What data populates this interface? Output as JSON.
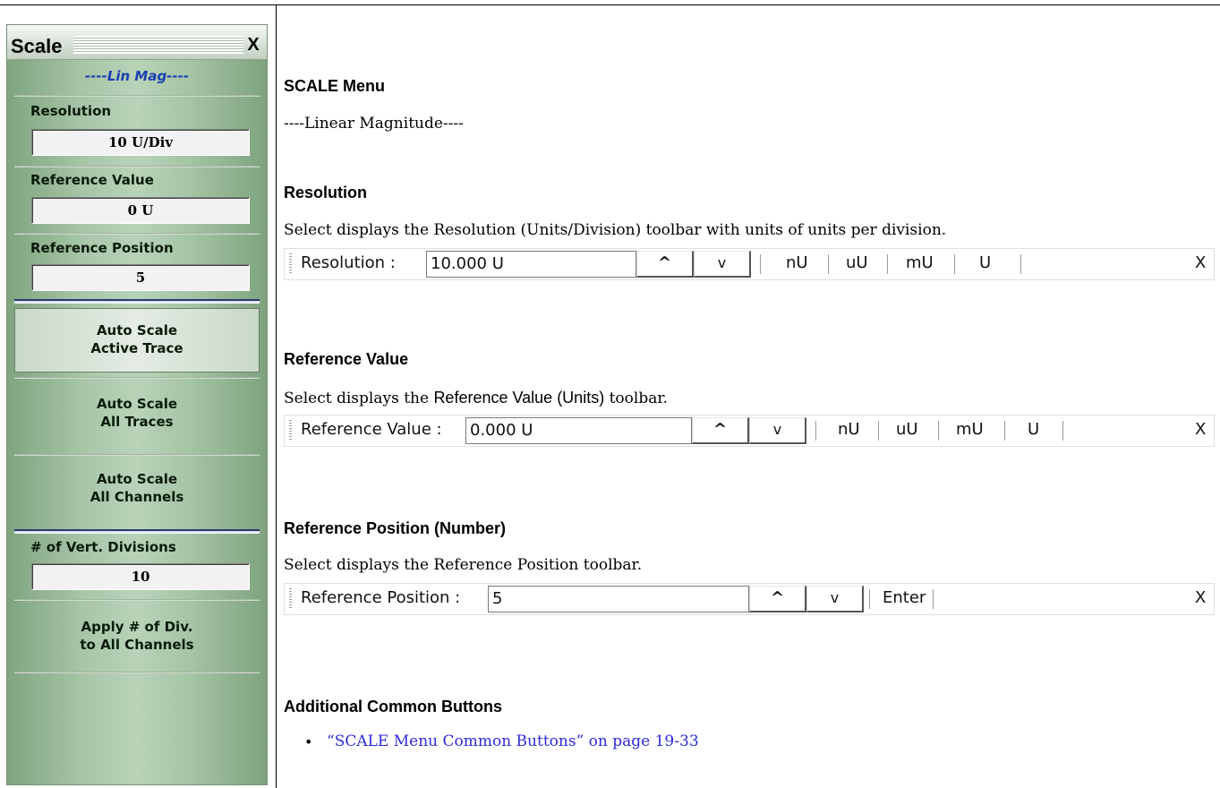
{
  "menu": {
    "title": "Scale",
    "close_label": "X",
    "subtitle": "----Lin Mag----",
    "resolution": {
      "label": "Resolution",
      "value": "10  U/Div"
    },
    "reference_value": {
      "label": "Reference Value",
      "value": "0  U"
    },
    "reference_position": {
      "label": "Reference Position",
      "value": "5"
    },
    "buttons": [
      {
        "line1": "Auto Scale",
        "line2": "Active Trace"
      },
      {
        "line1": "Auto Scale",
        "line2": "All Traces"
      },
      {
        "line1": "Auto Scale",
        "line2": "All Channels"
      }
    ],
    "vert_divisions": {
      "label": "# of Vert. Divisions",
      "value": "10"
    },
    "apply_button": {
      "line1": "Apply # of Div.",
      "line2": "to All Channels"
    }
  },
  "doc": {
    "heading_menu": "SCALE Menu",
    "subheading": "----Linear Magnitude----",
    "resolution": {
      "heading": "Resolution",
      "description": "Select displays the Resolution (Units/Division) toolbar with units of units per division.",
      "toolbar": {
        "label": "Resolution  :",
        "value": "10.000  U",
        "up": "^",
        "down": "v",
        "units": [
          "nU",
          "uU",
          "mU",
          "U"
        ],
        "close": "X"
      }
    },
    "reference_value": {
      "heading": "Reference Value",
      "desc_prefix": "Select displays the ",
      "desc_sans": "Reference Value (Units)",
      "desc_suffix": " toolbar.",
      "toolbar": {
        "label": "Reference Value  :",
        "value": "0.000  U",
        "up": "^",
        "down": "v",
        "units": [
          "nU",
          "uU",
          "mU",
          "U"
        ],
        "close": "X"
      }
    },
    "reference_position": {
      "heading": "Reference Position (Number)",
      "description": "Select displays the Reference Position toolbar.",
      "toolbar": {
        "label": "Reference Position  :",
        "value": "5",
        "up": "^",
        "down": "v",
        "enter": "Enter",
        "close": "X"
      }
    },
    "additional": {
      "heading": "Additional Common Buttons",
      "bullet": "•",
      "link": "“SCALE Menu Common Buttons” on page 19-33"
    }
  }
}
